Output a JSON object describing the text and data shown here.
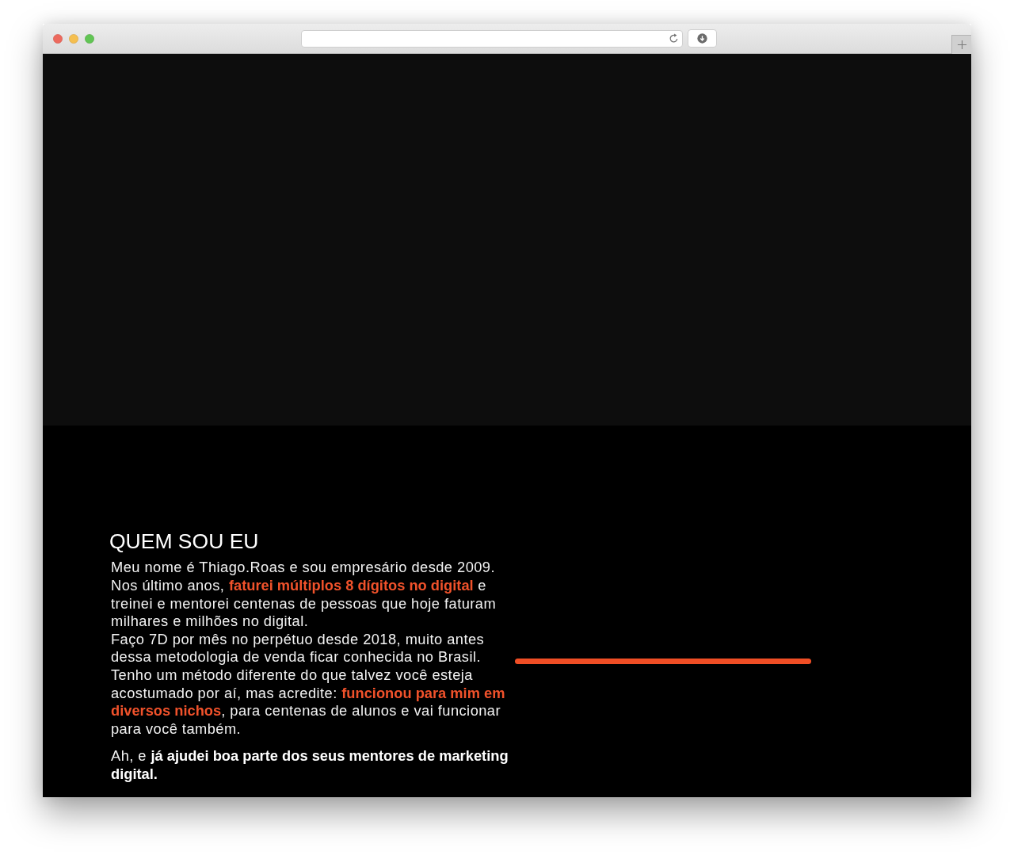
{
  "about": {
    "heading": "QUEM SOU EU",
    "paragraphs": [
      {
        "kind": "accent",
        "text": "Meu nome é Thiago.Roas e sou empresário desde 2009.\nNos último anos, **faturei múltiplos 8 dígitos no digital** e treinei e mentorei centenas de pessoas que hoje faturam milhares e milhões no digital.\nFaço 7D por mês no perpétuo desde 2018, muito antes dessa metodologia de venda ficar conhecida no Brasil.\nTenho um método diferente do que talvez você esteja acostumado por aí, mas acredite: **funcionou para mim em diversos nichos**, para centenas de alunos e vai funcionar para você também."
      },
      {
        "kind": "plain",
        "text": "Ah, e **já ajudei boa parte dos seus mentores de marketing digital.**"
      }
    ]
  }
}
